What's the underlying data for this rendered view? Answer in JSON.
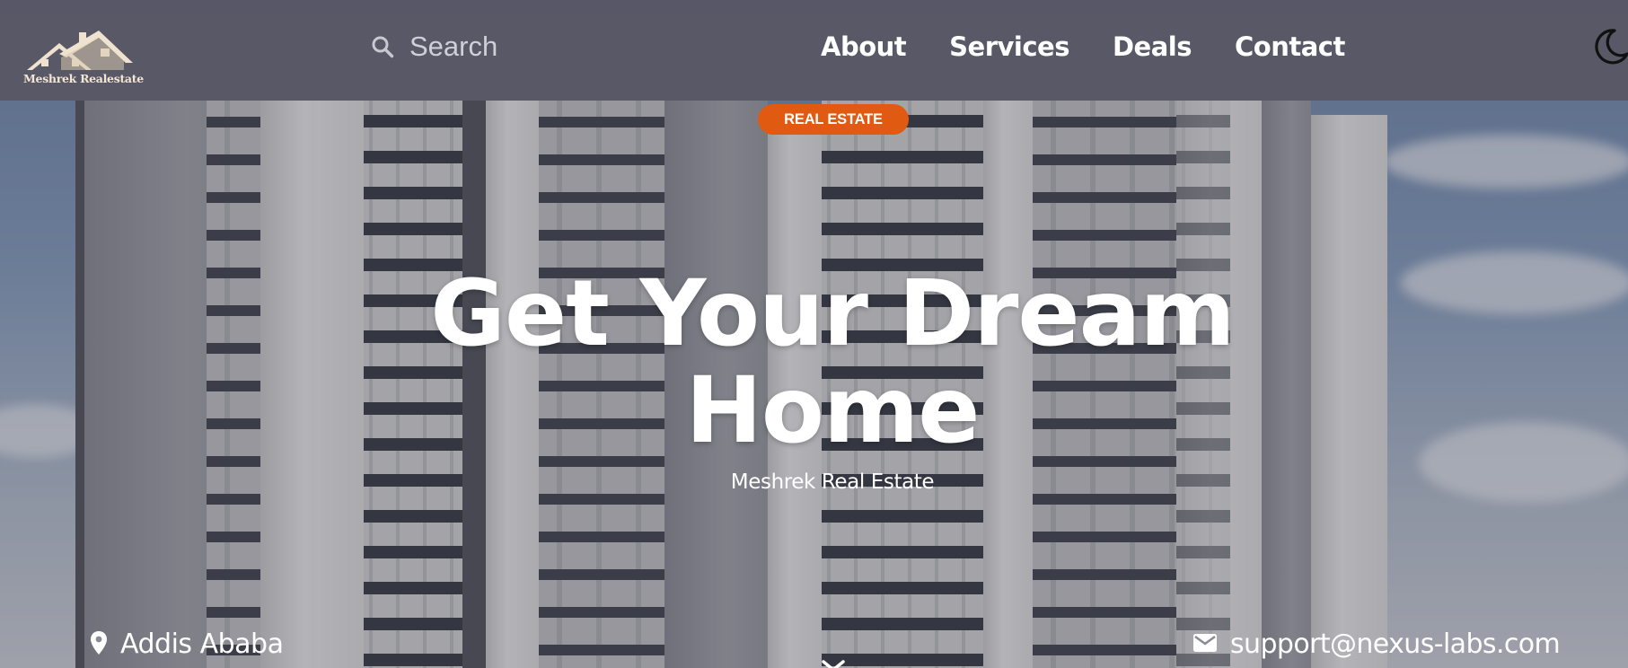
{
  "brand": {
    "name": "Meshrek Realestate"
  },
  "search": {
    "placeholder": "Search"
  },
  "nav": {
    "links": [
      {
        "label": "About"
      },
      {
        "label": "Services"
      },
      {
        "label": "Deals"
      },
      {
        "label": "Contact"
      }
    ],
    "theme_toggle_icon": "moon-icon"
  },
  "hero": {
    "badge": "REAL ESTATE",
    "headline_line1": "Get Your Dream",
    "headline_line2": "Home",
    "subtitle": "Meshrek Real Estate",
    "location": "Addis Ababa",
    "email": "support@nexus-labs.com",
    "scroll_icon": "chevron-down-icon"
  },
  "colors": {
    "navbar": "#58566a",
    "accent": "#e05a12",
    "text": "#ffffff"
  }
}
